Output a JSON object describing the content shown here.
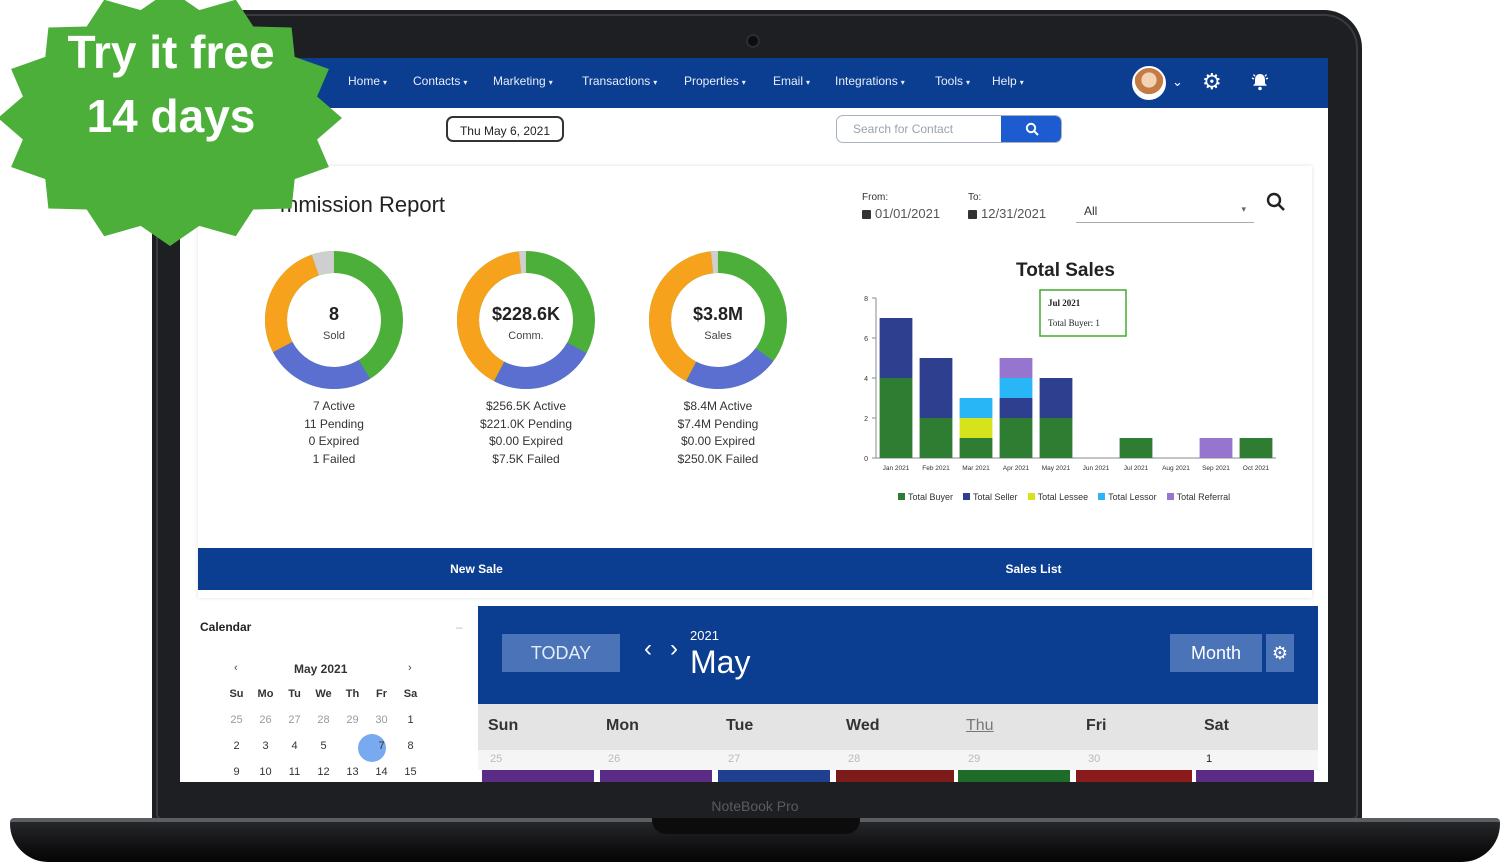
{
  "promo": {
    "line1": "Try it free",
    "line2": "14 days"
  },
  "device": {
    "brand": "NoteBook Pro"
  },
  "nav": {
    "items": [
      {
        "label": "Home"
      },
      {
        "label": "Contacts"
      },
      {
        "label": "Marketing"
      },
      {
        "label": "Transactions"
      },
      {
        "label": "Properties"
      },
      {
        "label": "Email"
      },
      {
        "label": "Integrations"
      },
      {
        "label": "Tools"
      },
      {
        "label": "Help"
      }
    ],
    "caret": "▾",
    "icons": {
      "avatar_caret": "chevron-down-icon",
      "settings": "gear-icon",
      "alerts": "bell-icon"
    }
  },
  "header": {
    "date": "Thu May 6, 2021",
    "search_placeholder": "Search for Contact"
  },
  "report": {
    "title": "mmission Report",
    "from_label": "From:",
    "from_value": "01/01/2021",
    "to_label": "To:",
    "to_value": "12/31/2021",
    "filter_value": "All"
  },
  "donuts": [
    {
      "main": "8",
      "sub": "Sold",
      "stats": [
        "7 Active",
        "11 Pending",
        "0 Expired",
        "1 Failed"
      ]
    },
    {
      "main": "$228.6K",
      "sub": "Comm.",
      "stats": [
        "$256.5K Active",
        "$221.0K Pending",
        "$0.00 Expired",
        "$7.5K Failed"
      ]
    },
    {
      "main": "$3.8M",
      "sub": "Sales",
      "stats": [
        "$8.4M Active",
        "$7.4M Pending",
        "$0.00 Expired",
        "$250.0K Failed"
      ]
    }
  ],
  "colors": {
    "nav": "#0b3d91",
    "green": "#4caf3a",
    "orange": "#f7a21c",
    "blue": "#5b6fd1",
    "gray": "#cfcfcf",
    "badge": "#4caf3a"
  },
  "chart_data": {
    "type": "bar",
    "title": "Total Sales",
    "stacked": true,
    "categories": [
      "Jan 2021",
      "Feb 2021",
      "Mar 2021",
      "Apr 2021",
      "May 2021",
      "Jun 2021",
      "Jul 2021",
      "Aug 2021",
      "Sep 2021",
      "Oct 2021"
    ],
    "series": [
      {
        "name": "Total Buyer",
        "color": "#2e7d32",
        "values": [
          4,
          2,
          1,
          2,
          2,
          0,
          1,
          0,
          0,
          1
        ]
      },
      {
        "name": "Total Seller",
        "color": "#2f3f8f",
        "values": [
          3,
          3,
          0,
          1,
          2,
          0,
          0,
          0,
          0,
          0
        ]
      },
      {
        "name": "Total Lessee",
        "color": "#d5e21c",
        "values": [
          0,
          0,
          1,
          0,
          0,
          0,
          0,
          0,
          0,
          0
        ]
      },
      {
        "name": "Total Lessor",
        "color": "#29b6f6",
        "values": [
          0,
          0,
          1,
          1,
          0,
          0,
          0,
          0,
          0,
          0
        ]
      },
      {
        "name": "Total Referral",
        "color": "#9575cd",
        "values": [
          0,
          0,
          0,
          1,
          0,
          0,
          0,
          0,
          1,
          0
        ]
      }
    ],
    "ylim": [
      0,
      8
    ],
    "yticks": [
      0,
      2,
      4,
      6,
      8
    ],
    "grid": false,
    "legend": "bottom",
    "tooltip": {
      "title": "Jul 2021",
      "label": "Total Buyer:",
      "value": "1"
    }
  },
  "actions": {
    "new_sale": "New Sale",
    "sales_list": "Sales List"
  },
  "mini_calendar": {
    "title": "Calendar",
    "month": "May 2021",
    "prev": "‹",
    "next": "›",
    "weekdays": [
      "Su",
      "Mo",
      "Tu",
      "We",
      "Th",
      "Fr",
      "Sa"
    ],
    "weeks": [
      [
        "25",
        "26",
        "27",
        "28",
        "29",
        "30",
        "1"
      ],
      [
        "2",
        "3",
        "4",
        "5",
        "6",
        "7",
        "8"
      ],
      [
        "9",
        "10",
        "11",
        "12",
        "13",
        "14",
        "15"
      ]
    ],
    "today": "6"
  },
  "calendar": {
    "today_label": "TODAY",
    "year": "2021",
    "month": "May",
    "view_label": "Month",
    "prev": "‹",
    "next": "›",
    "days": [
      "Sun",
      "Mon",
      "Tue",
      "Wed",
      "Thu",
      "Fri",
      "Sat"
    ],
    "first_row": [
      "25",
      "26",
      "27",
      "28",
      "29",
      "30",
      "1"
    ]
  }
}
